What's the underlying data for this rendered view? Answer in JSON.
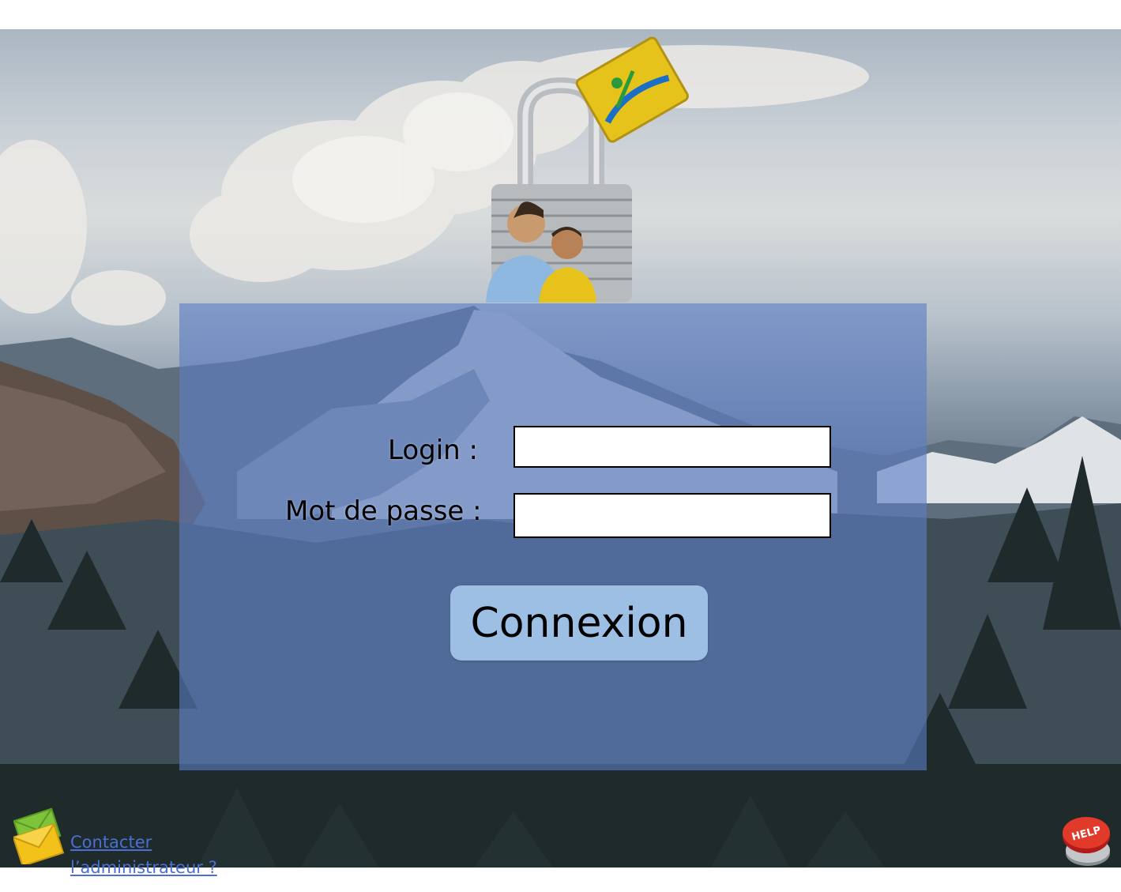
{
  "login": {
    "login_label": "Login :",
    "password_label": "Mot de passe :",
    "login_value": "",
    "password_value": "",
    "submit_label": "Connexion"
  },
  "footer": {
    "contact_link": "Contacter l’administrateur ?"
  },
  "icons": {
    "lock": "padlock-users-icon",
    "mail": "envelope-icon",
    "help": "help-button-icon"
  },
  "colors": {
    "panel": "#5a7cc4",
    "button": "#9cbfe3",
    "link": "#4a6fd4"
  }
}
